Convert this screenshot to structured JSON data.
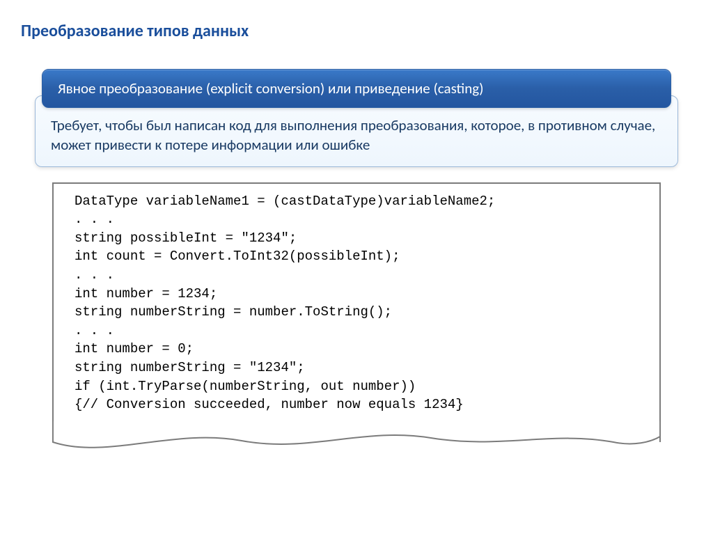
{
  "page_title": "Преобразование типов данных",
  "banner": "Явное преобразование (explicit conversion) или приведение (casting)",
  "info": "Требует, чтобы был написан код для выполнения преобразования, которое, в противном случае, может привести к потере информации или ошибке",
  "code_lines": [
    "DataType variableName1 = (castDataType)variableName2;",
    ". . .",
    "string possibleInt = \"1234\";",
    "int count = Convert.ToInt32(possibleInt);",
    ". . .",
    "int number = 1234;",
    "string numberString = number.ToString();",
    ". . .",
    "int number = 0;",
    "string numberString = \"1234\";",
    "if (int.TryParse(numberString, out number))",
    "{// Conversion succeeded, number now equals 1234}"
  ]
}
